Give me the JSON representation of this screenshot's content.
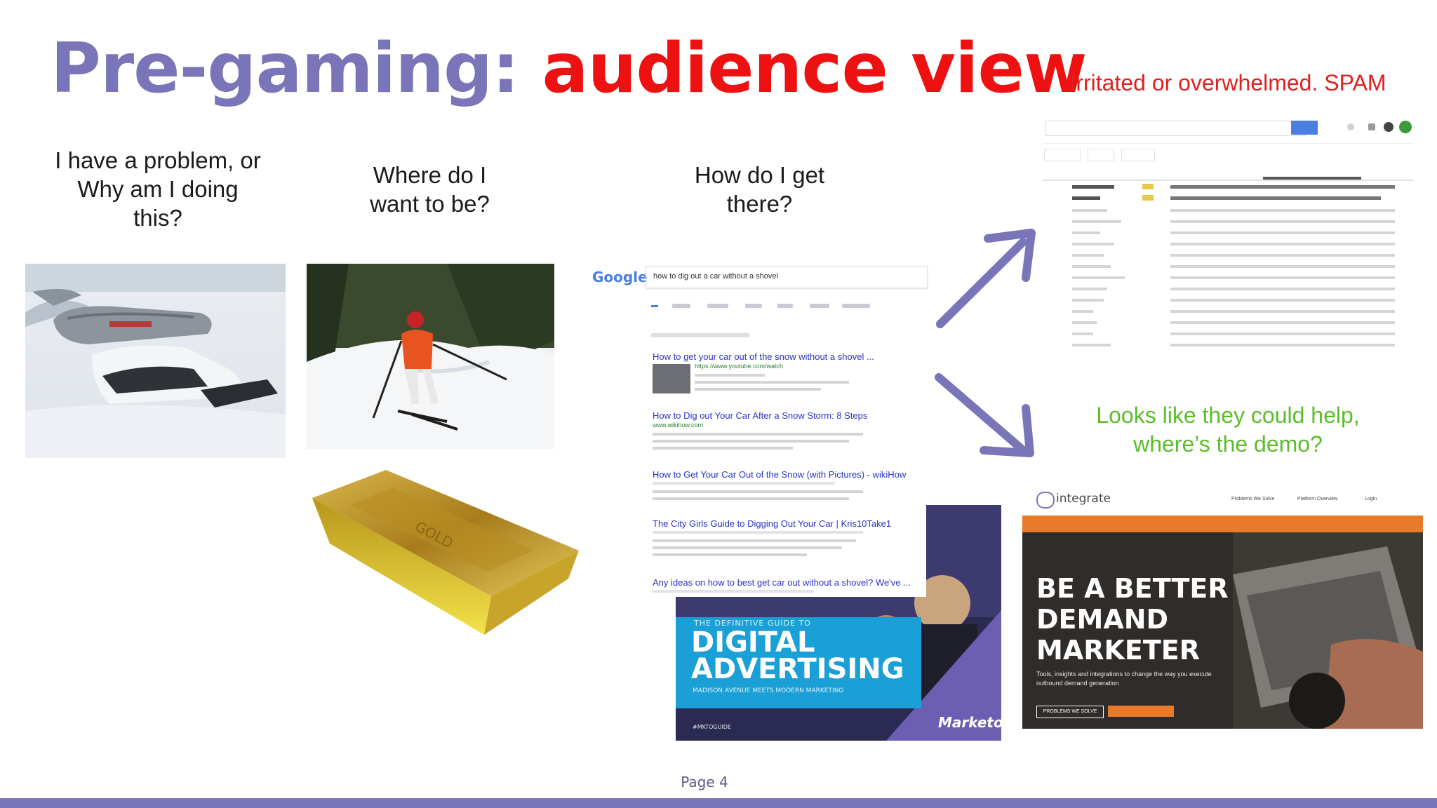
{
  "slide": {
    "title_part1": "Pre-gaming:",
    "title_part2": "audience view",
    "page_label": "Page 4",
    "colors": {
      "title_purple": "#7a75b8",
      "title_red": "#ee1111",
      "spam_red": "#e02020",
      "help_green": "#5bbd2a",
      "bar": "#7a75b8"
    }
  },
  "questions": {
    "problem": [
      "I have a problem, or",
      "Why am I doing",
      "this?"
    ],
    "goal": [
      "Where do I",
      "want to be?"
    ],
    "path": [
      "How do I get",
      "there?"
    ]
  },
  "outcomes": {
    "spam": "Irritated or overwhelmed. SPAM",
    "help": [
      "Looks like they could help,",
      "where’s the demo?"
    ]
  },
  "google_panel": {
    "logo": "Google",
    "query": "how to dig out a car without a shovel",
    "results": [
      "How to get your car out of the snow without a shovel ...",
      "How to Dig out Your Car After a Snow Storm: 8 Steps",
      "How to Get Your Car Out of the Snow (with Pictures) - wikiHow",
      "The City Girls Guide to Digging Out Your Car | Kris10Take1",
      "Any ideas on how to best get car out without a shovel? We've ..."
    ]
  },
  "marketo_panel": {
    "kicker": "THE DEFINITIVE GUIDE TO",
    "headline_1": "DIGITAL",
    "headline_2": "ADVERTISING",
    "subtitle": "MADISON AVENUE MEETS MODERN MARKETING",
    "tag": "#MKTOGUIDE",
    "brand": "Marketo"
  },
  "integrate_panel": {
    "logo": "integrate",
    "nav": [
      "Problems We Solve",
      "Platform Overview",
      "Login"
    ],
    "headline": [
      "BE A BETTER",
      "DEMAND",
      "MARKETER"
    ],
    "tagline": "Tools, insights and integrations to change the way you execute outbound demand generation",
    "cta": "PROBLEMS WE SOLVE"
  },
  "icons": [
    "arrow-up-right-icon",
    "arrow-down-right-icon"
  ]
}
